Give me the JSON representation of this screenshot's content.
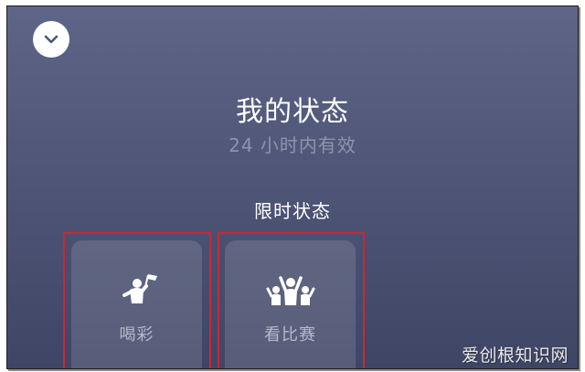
{
  "header": {
    "collapse_icon": "chevron-down-icon",
    "title": "我的状态",
    "subtitle": "24 小时内有效"
  },
  "section": {
    "title": "限时状态"
  },
  "status_cards": [
    {
      "label": "喝彩",
      "icon": "cheer-person-flag-icon"
    },
    {
      "label": "看比赛",
      "icon": "crowd-cheering-icon"
    }
  ],
  "watermark": "爱创根知识网",
  "colors": {
    "background_top": "#5e6587",
    "background_bottom": "#3f4665",
    "subtitle_text": "#8e94ad",
    "card_label": "#b4b9cc",
    "highlight_box": "#c8283a"
  }
}
